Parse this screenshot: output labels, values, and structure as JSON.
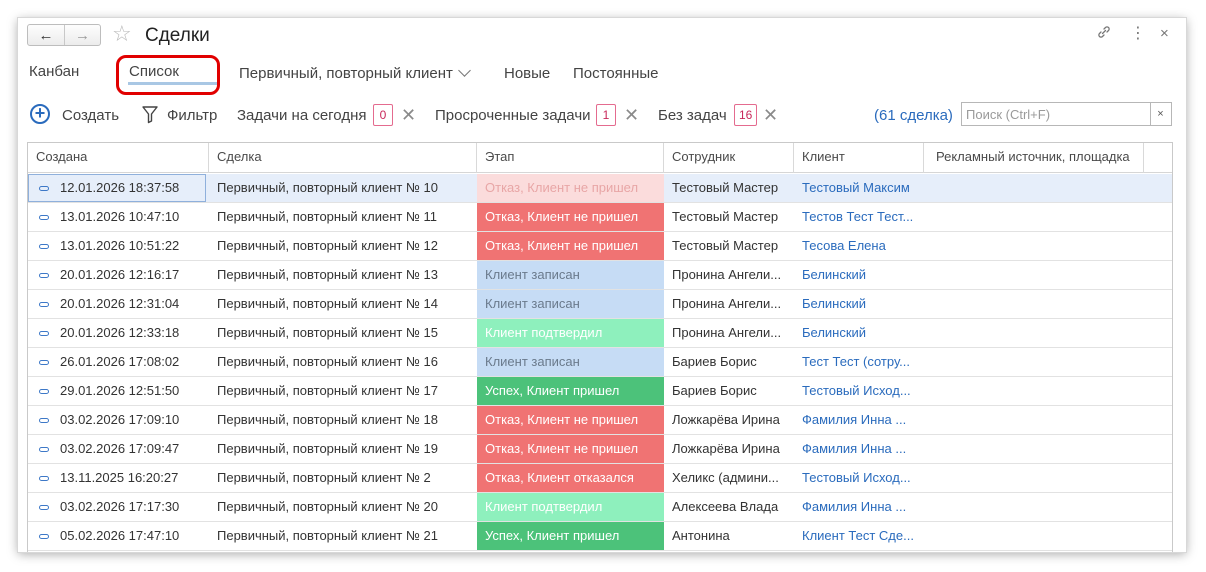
{
  "window": {
    "title": "Сделки",
    "nav": {
      "back": "←",
      "forward": "→"
    },
    "star_icon": "star-icon",
    "actions": [
      "link-icon",
      "more-vertical-icon",
      "close-icon"
    ],
    "action_glyphs": {
      "link": "🔗",
      "more": "⋮",
      "close": "×"
    }
  },
  "tabs": [
    {
      "label": "Канбан",
      "active": false
    },
    {
      "label": "Список",
      "active": true
    },
    {
      "label": "Первичный, повторный клиент",
      "active": false,
      "dropdown": true
    },
    {
      "label": "Новые",
      "active": false
    },
    {
      "label": "Постоянные",
      "active": false
    }
  ],
  "toolbar": {
    "create_label": "Создать",
    "filter_label": "Фильтр",
    "tasks_today_label": "Задачи на сегодня",
    "tasks_today_count": "0",
    "overdue_label": "Просроченные задачи",
    "overdue_count": "1",
    "no_tasks_label": "Без задач",
    "no_tasks_count": "16",
    "deals_count": "(61 сделка)",
    "search_placeholder": "Поиск (Ctrl+F)",
    "clear_glyph": "×",
    "remove_glyph": "✕"
  },
  "table": {
    "columns": [
      "Создана",
      "Сделка",
      "Этап",
      "Сотрудник",
      "Клиент",
      "Рекламный источник, площадка"
    ],
    "stage_colors": {
      "refusal": "#f07373",
      "refusal_light": "#fbdcdc",
      "registered": "#c6dcf5",
      "confirmed": "#8ef0bd",
      "success": "#4cc27a"
    },
    "rows": [
      {
        "created": "12.01.2026 18:37:58",
        "deal": "Первичный, повторный клиент № 10",
        "stage": "Отказ, Клиент не пришел",
        "stage_type": "refusal_light",
        "employee": "Тестовый Мастер",
        "client": "Тестовый Максим",
        "source": ""
      },
      {
        "created": "13.01.2026 10:47:10",
        "deal": "Первичный, повторный клиент № 11",
        "stage": "Отказ, Клиент не пришел",
        "stage_type": "refusal",
        "employee": "Тестовый Мастер",
        "client": "Тестов Тест Тест...",
        "source": ""
      },
      {
        "created": "13.01.2026 10:51:22",
        "deal": "Первичный, повторный клиент № 12",
        "stage": "Отказ, Клиент не пришел",
        "stage_type": "refusal",
        "employee": "Тестовый Мастер",
        "client": "Тесова Елена",
        "source": ""
      },
      {
        "created": "20.01.2026 12:16:17",
        "deal": "Первичный, повторный клиент № 13",
        "stage": "Клиент записан",
        "stage_type": "registered",
        "employee": "Пронина Ангели...",
        "client": "Белинский",
        "source": ""
      },
      {
        "created": "20.01.2026 12:31:04",
        "deal": "Первичный, повторный клиент № 14",
        "stage": "Клиент записан",
        "stage_type": "registered",
        "employee": "Пронина Ангели...",
        "client": "Белинский",
        "source": ""
      },
      {
        "created": "20.01.2026 12:33:18",
        "deal": "Первичный, повторный клиент № 15",
        "stage": "Клиент подтвердил",
        "stage_type": "confirmed",
        "employee": "Пронина Ангели...",
        "client": "Белинский",
        "source": ""
      },
      {
        "created": "26.01.2026 17:08:02",
        "deal": "Первичный, повторный клиент № 16",
        "stage": "Клиент записан",
        "stage_type": "registered",
        "employee": "Бариев Борис",
        "client": "Тест Тест (сотру...",
        "source": ""
      },
      {
        "created": "29.01.2026 12:51:50",
        "deal": "Первичный, повторный клиент № 17",
        "stage": "Успех, Клиент пришел",
        "stage_type": "success",
        "employee": "Бариев Борис",
        "client": "Тестовый Исход...",
        "source": ""
      },
      {
        "created": "03.02.2026 17:09:10",
        "deal": "Первичный, повторный клиент № 18",
        "stage": "Отказ, Клиент не пришел",
        "stage_type": "refusal",
        "employee": "Ложкарёва Ирина",
        "client": "Фамилия Инна ...",
        "source": ""
      },
      {
        "created": "03.02.2026 17:09:47",
        "deal": "Первичный, повторный клиент № 19",
        "stage": "Отказ, Клиент не пришел",
        "stage_type": "refusal",
        "employee": "Ложкарёва Ирина",
        "client": "Фамилия Инна ...",
        "source": ""
      },
      {
        "created": "13.11.2025 16:20:27",
        "deal": "Первичный, повторный клиент № 2",
        "stage": "Отказ, Клиент отказался",
        "stage_type": "refusal",
        "employee": "Хеликс (админи...",
        "client": "Тестовый Исход...",
        "source": ""
      },
      {
        "created": "03.02.2026 17:17:30",
        "deal": "Первичный, повторный клиент № 20",
        "stage": "Клиент подтвердил",
        "stage_type": "confirmed",
        "employee": "Алексеева Влада",
        "client": "Фамилия Инна ...",
        "source": ""
      },
      {
        "created": "05.02.2026 17:47:10",
        "deal": "Первичный, повторный клиент № 21",
        "stage": "Успех, Клиент пришел",
        "stage_type": "success",
        "employee": "Антонина",
        "client": "Клиент Тест Сде...",
        "source": ""
      }
    ]
  }
}
